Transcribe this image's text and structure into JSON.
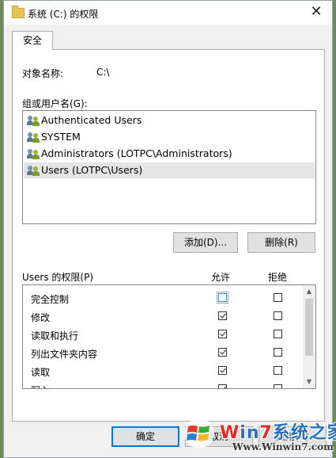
{
  "window": {
    "title": "系统 (C:) 的权限",
    "close_glyph": "✕"
  },
  "tabs": [
    {
      "label": "安全",
      "active": true
    }
  ],
  "object": {
    "label": "对象名称:",
    "value": "C:\\"
  },
  "group": {
    "label": "组或用户名(G):",
    "users": [
      {
        "name": "Authenticated Users",
        "selected": false
      },
      {
        "name": "SYSTEM",
        "selected": false
      },
      {
        "name": "Administrators (LOTPC\\Administrators)",
        "selected": false
      },
      {
        "name": "Users (LOTPC\\Users)",
        "selected": true
      }
    ]
  },
  "buttons": {
    "add": "添加(D)...",
    "remove": "删除(R)",
    "ok": "确定",
    "cancel": "取消",
    "apply": "应用(A)"
  },
  "permissions": {
    "label": "Users 的权限(P)",
    "allow_header": "允许",
    "deny_header": "拒绝",
    "rows": [
      {
        "name": "完全控制",
        "allow": false,
        "deny": false
      },
      {
        "name": "修改",
        "allow": true,
        "deny": false
      },
      {
        "name": "读取和执行",
        "allow": true,
        "deny": false
      },
      {
        "name": "列出文件夹内容",
        "allow": true,
        "deny": false
      },
      {
        "name": "读取",
        "allow": true,
        "deny": false
      },
      {
        "name": "写入",
        "allow": true,
        "deny": false
      }
    ]
  },
  "watermark": {
    "brand_w": "W",
    "brand_in": "in",
    "brand_7": "7",
    "brand_cn": "系统之家",
    "url": "Www.Winwin7.com"
  }
}
